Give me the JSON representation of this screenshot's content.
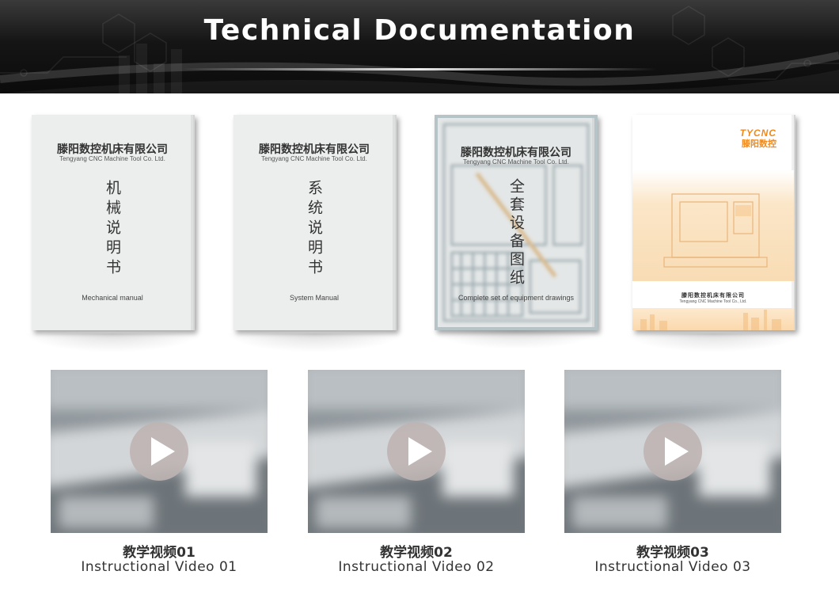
{
  "header": {
    "title": "Technical Documentation"
  },
  "manuals": [
    {
      "company_cn": "滕阳数控机床有限公司",
      "company_en": "Tengyang CNC Machine Tool Co. Ltd.",
      "title_cn": "机械说明书",
      "title_en": "Mechanical manual"
    },
    {
      "company_cn": "滕阳数控机床有限公司",
      "company_en": "Tengyang CNC Machine Tool Co. Ltd.",
      "title_cn": "系统说明书",
      "title_en": "System Manual"
    },
    {
      "company_cn": "滕阳数控机床有限公司",
      "company_en": "Tengyang CNC Machine Tool Co. Ltd.",
      "title_cn": "全套设备图纸",
      "title_en": "Complete set of equipment drawings"
    },
    {
      "logo_en": "TYCNC",
      "logo_cn": "滕阳数控",
      "company_cn": "滕阳数控机床有限公司",
      "company_en": "Tengyang CNC Machine Tool Co., Ltd."
    }
  ],
  "videos": [
    {
      "title_cn": "教学视频01",
      "title_en": "Instructional Video 01"
    },
    {
      "title_cn": "教学视频02",
      "title_en": "Instructional Video 02"
    },
    {
      "title_cn": "教学视频03",
      "title_en": "Instructional Video 03"
    }
  ],
  "colors": {
    "accent": "#f08a1c",
    "header_bg": "#111111",
    "play_button": "#bdb4b2"
  },
  "icons": {
    "play": "play-icon"
  }
}
